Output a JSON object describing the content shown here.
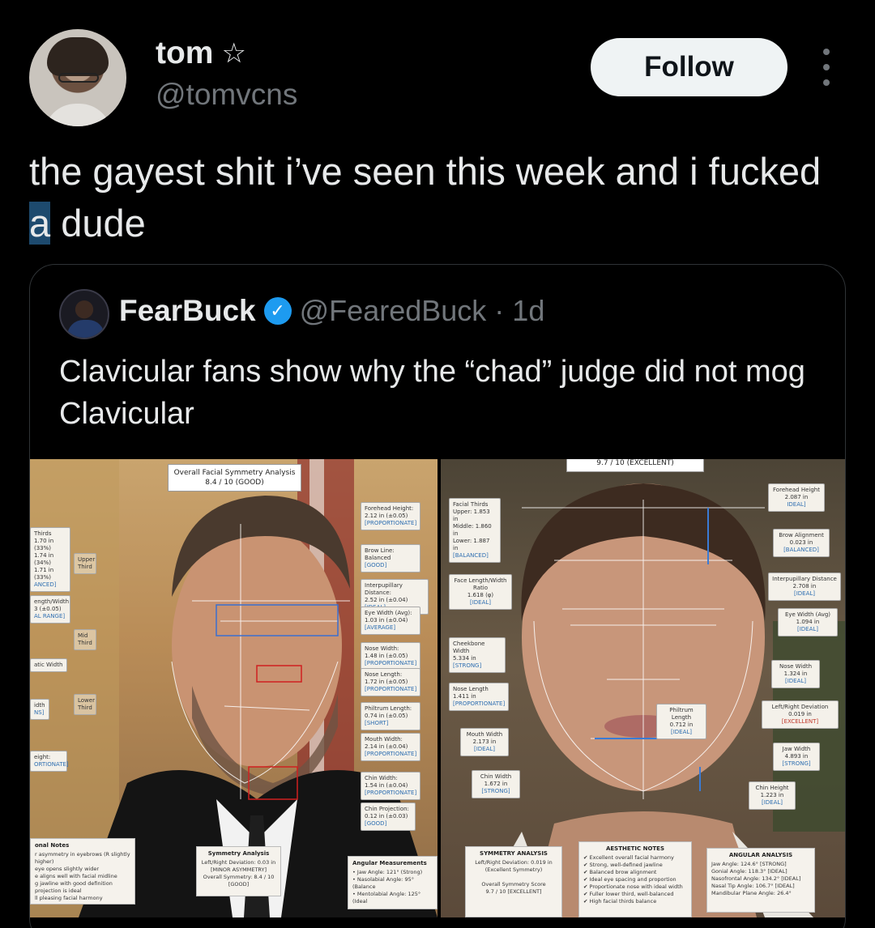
{
  "post": {
    "display_name": "tom",
    "handle": "@tomvcns",
    "follow_label": "Follow",
    "text_before": "the gayest shit i’ve seen this week and i fucked ",
    "text_selected": "a",
    "text_after": " dude"
  },
  "quote": {
    "display_name": "FearBuck",
    "handle": "@FearedBuck",
    "separator": "·",
    "time": "1d",
    "text": "Clavicular fans show why the “chad” judge did not mog Clavicular"
  },
  "left_image": {
    "title": "Overall Facial Symmetry Analysis\n8.4 / 10 (GOOD)",
    "labels": [
      {
        "text": "Forehead Height:\n2.12 in (±0.05)",
        "tag": "[PROPORTIONATE]"
      },
      {
        "text": "Brow Line:\nBalanced",
        "tag": "[GOOD]"
      },
      {
        "text": "Interpupillary Distance:\n2.52 in (±0.04)",
        "tag": "[IDEAL]"
      },
      {
        "text": "Eye Width (Avg):\n1.03 in (±0.04)",
        "tag": "[AVERAGE]"
      },
      {
        "text": "Nose Width:\n1.48 in (±0.05)",
        "tag": "[PROPORTIONATE]"
      },
      {
        "text": "Nose Length:\n1.72 in (±0.05)",
        "tag": "[PROPORTIONATE]"
      },
      {
        "text": "Philtrum Length:\n0.74 in (±0.05)",
        "tag": "[SHORT]"
      },
      {
        "text": "Mouth Width:\n2.14 in (±0.04)",
        "tag": "[PROPORTIONATE]"
      },
      {
        "text": "Chin Width:\n1.54 in (±0.04)",
        "tag": "[PROPORTIONATE]"
      },
      {
        "text": "Chin Projection:\n0.12 in (±0.03)",
        "tag": "[GOOD]"
      }
    ],
    "left_labels": [
      {
        "text": "Thirds\n1.70 in (33%)\n1.74 in (34%)\n1.71 in (33%)",
        "tag": "ANCED]"
      },
      {
        "text": "ength/Width\n3 (±0.05)",
        "tag": "AL RANGE]"
      },
      {
        "text": "atic Width",
        "tag": ""
      },
      {
        "text": "idth",
        "tag": "NS]"
      },
      {
        "text": "eight:",
        "tag": "ORTIONATE]"
      }
    ],
    "zones": [
      "Upper\nThird",
      "Mid\nThird",
      "Lower\nThird"
    ],
    "notes_panel": {
      "title": "onal Notes",
      "lines": "r asymmetry in eyebrows (R slightly higher)\neye opens slightly wider\ne aligns well with facial midline\ng jawline with good definition\nprojection is ideal\nll pleasing facial harmony"
    },
    "symmetry_panel": {
      "title": "Symmetry Analysis",
      "lines": "Left/Right Deviation: 0.03 in\n[MINOR ASYMMETRY]\nOverall Symmetry: 8.4 / 10\n[GOOD]"
    },
    "angular_panel": {
      "title": "Angular Measurements",
      "lines": "• Jaw Angle: 121° (Strong)\n• Nasolabial Angle: 95° (Balance\n• Mentolabial Angle: 125° (Ideal"
    }
  },
  "right_image": {
    "title": "9.7 / 10 (EXCELLENT)",
    "labels_left": [
      {
        "text": "Facial Thirds\nUpper: 1.853 in\nMiddle: 1.860 in\nLower: 1.887 in",
        "tag": "[BALANCED]"
      },
      {
        "text": "Face Length/Width\nRatio\n1.618 (φ)",
        "tag": "[IDEAL]"
      },
      {
        "text": "Cheekbone Width\n5.334 in",
        "tag": "[STRONG]"
      },
      {
        "text": "Nose Length\n1.411 in",
        "tag": "[PROPORTIONATE]"
      },
      {
        "text": "Mouth Width\n2.173 in",
        "tag": "[IDEAL]"
      },
      {
        "text": "Chin Width\n1.672 in",
        "tag": "[STRONG]"
      }
    ],
    "labels_right": [
      {
        "text": "Forehead Height\n2.087 in",
        "tag": "IDEAL]"
      },
      {
        "text": "Brow Alignment\n0.023 in",
        "tag": "[BALANCED]"
      },
      {
        "text": "Interpupillary Distance\n2.708 in",
        "tag": "[IDEAL]"
      },
      {
        "text": "Eye Width (Avg)\n1.094 in",
        "tag": "[IDEAL]"
      },
      {
        "text": "Nose Width\n1.324 in",
        "tag": "[IDEAL]"
      },
      {
        "text": "Left/Right Deviation\n0.019 in",
        "tag": "[EXCELLENT]"
      },
      {
        "text": "Jaw Width\n4.893 in",
        "tag": "[STRONG]"
      },
      {
        "text": "Chin Height\n1.223 in",
        "tag": "[IDEAL]"
      }
    ],
    "philtrum_label": {
      "text": "Philtrum Length\n0.712 in",
      "tag": "[IDEAL]"
    },
    "symmetry_panel": {
      "title": "SYMMETRY ANALYSIS",
      "lines": "Left/Right Deviation: 0.019 in\n(Excellent Symmetry)\n\nOverall Symmetry Score\n9.7 / 10 [EXCELLENT]"
    },
    "aesthetic_panel": {
      "title": "AESTHETIC NOTES",
      "lines": "✔ Excellent overall facial harmony\n✔ Strong, well-defined jawline\n✔ Balanced brow alignment\n✔ Ideal eye spacing and proportion\n✔ Proportionate nose with ideal width\n✔ Fuller lower third, well-balanced\n✔ High facial thirds balance"
    },
    "angular_panel": {
      "title": "ANGULAR ANALYSIS",
      "lines": "Jaw Angle: 124.6°   [STRONG]\nGonial Angle: 118.3°   [IDEAL]\nNasofrontal Angle: 134.2°   [IDEAL]\nNasal Tip Angle: 106.7°   [IDEAL]\nMandibular Plane Angle: 26.4°"
    }
  },
  "colors": {
    "background": "#000000",
    "text": "#e7e9ea",
    "muted": "#71767b",
    "verified": "#1d9bf0",
    "selection": "#1d4a6e"
  }
}
